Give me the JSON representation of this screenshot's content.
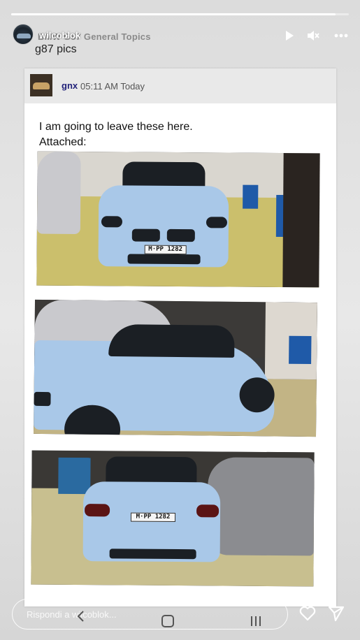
{
  "story": {
    "progress": 0.96,
    "username": "wilcoblok",
    "forum_crumb": "BMW G87 General Topics",
    "thread_title": "g87 pics",
    "reply_placeholder": "Rispondi a wilcoblok..."
  },
  "post": {
    "author": "gnx",
    "time": "05:11 AM Today",
    "lines": [
      "I am going to leave these here.",
      "Attached:"
    ]
  },
  "photos": [
    {
      "plate": "M·PP 1282"
    },
    {
      "plate": ""
    },
    {
      "plate": "M·PP 1282"
    }
  ],
  "icons": {
    "play": "play-icon",
    "mute": "mute-icon",
    "more": "more-icon",
    "heart": "heart-icon",
    "send": "send-icon",
    "back": "back-icon",
    "home": "home-icon",
    "recent": "recent-apps-icon"
  },
  "colors": {
    "car_blue": "#a9c8e8",
    "author_link": "#22227a",
    "post_header": "#e9e9e9"
  }
}
